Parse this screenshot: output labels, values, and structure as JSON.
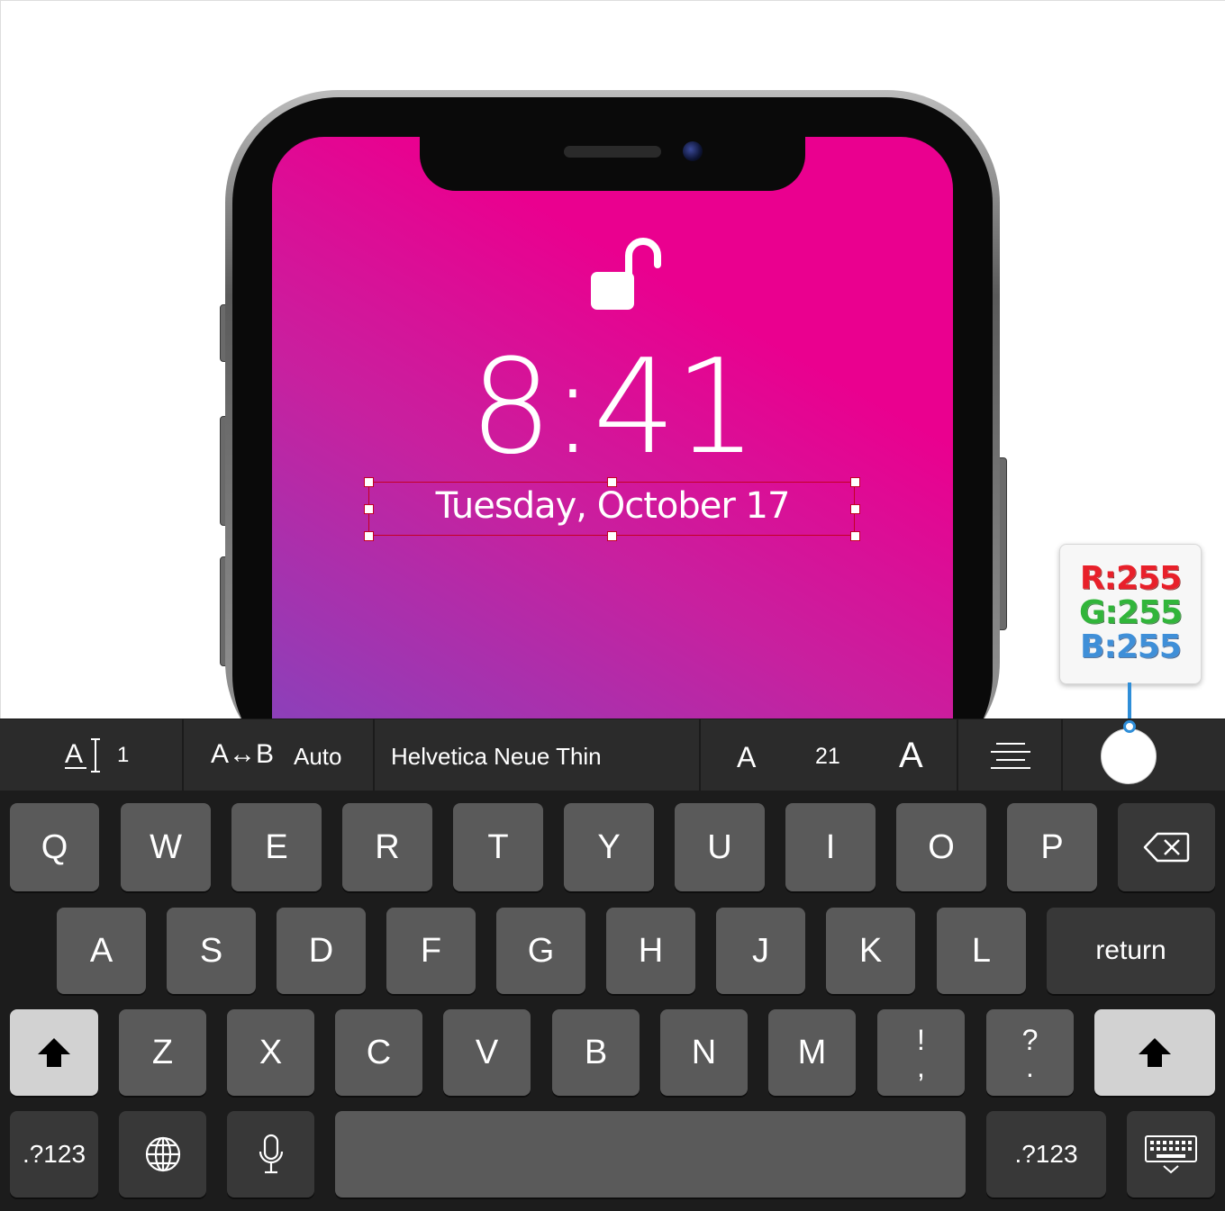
{
  "lockscreen": {
    "time": "8:41",
    "date": "Tuesday, October 17",
    "gradient_colors": [
      "#ea008f",
      "#8444bd"
    ]
  },
  "color_badge": {
    "r": "R:255",
    "g": "G:255",
    "b": "B:255"
  },
  "toolbar": {
    "line_spacing_icon": "text-baseline-icon",
    "line_spacing_value": "1",
    "char_spacing_label": "A↔B",
    "char_spacing_value": "Auto",
    "font_name": "Helvetica Neue Thin",
    "size_decrease_label": "A",
    "font_size": "21",
    "size_increase_label": "A",
    "alignment_icon": "align-center-icon",
    "fill_color": "#ffffff"
  },
  "keyboard": {
    "row1": [
      "Q",
      "W",
      "E",
      "R",
      "T",
      "Y",
      "U",
      "I",
      "O",
      "P"
    ],
    "row2": [
      "A",
      "S",
      "D",
      "F",
      "G",
      "H",
      "J",
      "K",
      "L"
    ],
    "row3": [
      "Z",
      "X",
      "C",
      "V",
      "B",
      "N",
      "M"
    ],
    "punct1_top": "!",
    "punct1_bottom": ",",
    "punct2_top": "?",
    "punct2_bottom": ".",
    "return_label": "return",
    "numbers_left": ".?123",
    "numbers_right": ".?123",
    "backspace_icon": "backspace-icon",
    "shift_icon": "shift-icon",
    "globe_icon": "globe-icon",
    "mic_icon": "microphone-icon",
    "dismiss_icon": "keyboard-dismiss-icon"
  }
}
